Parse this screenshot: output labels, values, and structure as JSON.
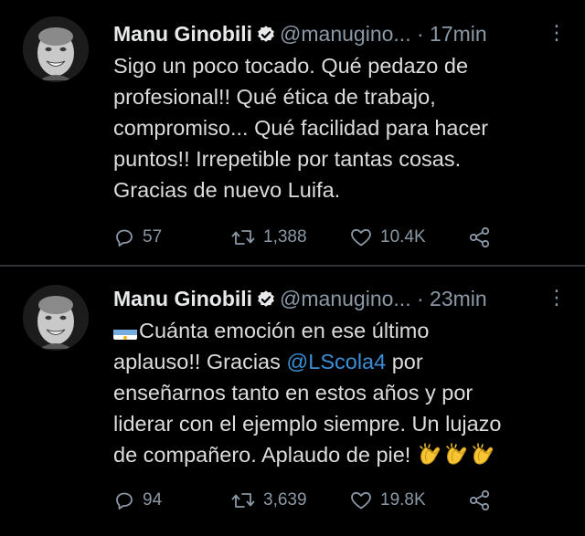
{
  "colors": {
    "background": "#000000",
    "text": "#dcdcdc",
    "secondary": "#8b98a5",
    "mention": "#3a8fd6",
    "verified": "#e7e9ea"
  },
  "tweets": [
    {
      "author_name": "Manu Ginobili",
      "handle": "@manugino...",
      "time": "· 17min",
      "lines": [
        "Sigo un poco tocado. Qué pedazo de",
        "profesional!! Qué ética de trabajo,",
        "compromiso... Qué facilidad para hacer",
        "puntos!! Irrepetible por tantas cosas.",
        "Gracias de nuevo Luifa."
      ],
      "replies": "57",
      "retweets": "1,388",
      "likes": "10.4K"
    },
    {
      "author_name": "Manu Ginobili",
      "handle": "@manugino...",
      "time": "· 23min",
      "line1": "Cuánta emoción en ese último",
      "line2_before": "aplauso!! Gracias ",
      "mention": "@LScola4",
      "line2_after": " por",
      "line3": "enseñarnos tanto en estos años y por",
      "line4": "liderar con el ejemplo siempre. Un lujazo",
      "line5": "de compañero. Aplaudo de pie!",
      "replies": "94",
      "retweets": "3,639",
      "likes": "19.8K"
    }
  ],
  "icons": {
    "verified": "verified-badge-icon",
    "more": "more-vertical-icon",
    "reply": "reply-icon",
    "retweet": "retweet-icon",
    "like": "heart-icon",
    "share": "share-icon",
    "flag": "argentina-flag-emoji",
    "clap": "clapping-hands-emoji"
  }
}
